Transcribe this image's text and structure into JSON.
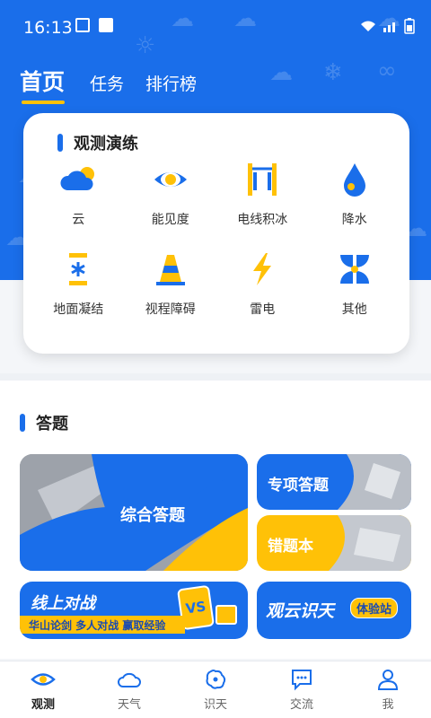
{
  "status_bar": {
    "time": "16:13"
  },
  "top_tabs": [
    {
      "label": "首页",
      "active": true
    },
    {
      "label": "任务",
      "active": false
    },
    {
      "label": "排行榜",
      "active": false
    }
  ],
  "practice": {
    "title": "观测演练",
    "items": [
      {
        "label": "云",
        "icon": "cloud-icon"
      },
      {
        "label": "能见度",
        "icon": "eye-icon"
      },
      {
        "label": "电线积冰",
        "icon": "wire-ice-icon"
      },
      {
        "label": "降水",
        "icon": "raindrop-icon"
      },
      {
        "label": "地面凝结",
        "icon": "frost-icon"
      },
      {
        "label": "视程障碍",
        "icon": "cone-icon"
      },
      {
        "label": "雷电",
        "icon": "lightning-icon"
      },
      {
        "label": "其他",
        "icon": "grid-icon"
      }
    ]
  },
  "answer": {
    "title": "答题",
    "comprehensive": "综合答题",
    "special": "专项答题",
    "wrong_book": "错题本",
    "battle": {
      "title": "线上对战",
      "badge": "VS",
      "subtitle": "华山论剑 多人对战 赢取经验"
    },
    "cloud": {
      "title": "观云识天",
      "badge": "体验站"
    }
  },
  "bottom_nav": [
    {
      "label": "观测",
      "icon": "eye-nav-icon",
      "active": true
    },
    {
      "label": "天气",
      "icon": "cloud-nav-icon",
      "active": false
    },
    {
      "label": "识天",
      "icon": "brain-nav-icon",
      "active": false
    },
    {
      "label": "交流",
      "icon": "chat-nav-icon",
      "active": false
    },
    {
      "label": "我",
      "icon": "person-nav-icon",
      "active": false
    }
  ],
  "colors": {
    "primary": "#1a6eea",
    "accent": "#ffc107"
  }
}
